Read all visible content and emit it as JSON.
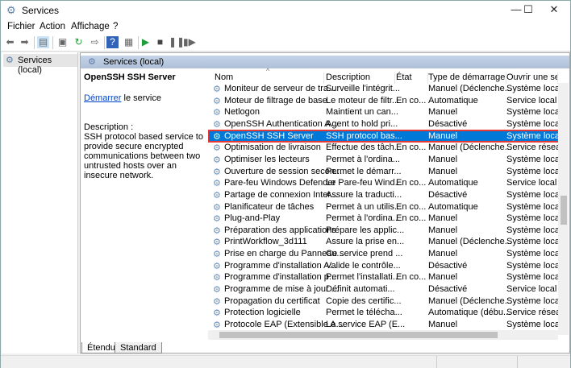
{
  "window": {
    "title": "Services",
    "minimize": "—",
    "maximize": "☐",
    "close": "✕"
  },
  "menu": [
    "Fichier",
    "Action",
    "Affichage",
    "?"
  ],
  "tree": {
    "root": "Services (local)"
  },
  "panel": {
    "header": "Services (local)",
    "service_name": "OpenSSH SSH Server",
    "start_link": "Démarrer",
    "start_suffix": " le service",
    "description_label": "Description :",
    "description": "SSH protocol based service to provide secure encrypted communications between two untrusted hosts over an insecure network."
  },
  "columns": [
    "Nom",
    "Description",
    "État",
    "Type de démarrage",
    "Ouvrir une sessi"
  ],
  "rows": [
    [
      "Moniteur de serveur de tra...",
      "Surveille l'intégrit...",
      "",
      "Manuel (Déclenche...",
      "Système local"
    ],
    [
      "Moteur de filtrage de base",
      "Le moteur de filtr...",
      "En co...",
      "Automatique",
      "Service local"
    ],
    [
      "Netlogon",
      "Maintient un can...",
      "",
      "Manuel",
      "Système local"
    ],
    [
      "OpenSSH Authentication A...",
      "Agent to hold pri...",
      "",
      "Désactivé",
      "Système local"
    ],
    [
      "OpenSSH SSH Server",
      "SSH protocol bas...",
      "",
      "Manuel",
      "Système local"
    ],
    [
      "Optimisation de livraison",
      "Effectue des tâch...",
      "En co...",
      "Manuel (Déclenche...",
      "Service réseau"
    ],
    [
      "Optimiser les lecteurs",
      "Permet à l'ordina...",
      "",
      "Manuel",
      "Système local"
    ],
    [
      "Ouverture de session secon...",
      "Permet le démarr...",
      "",
      "Manuel",
      "Système local"
    ],
    [
      "Pare-feu Windows Defender",
      "Le Pare-feu Wind...",
      "En co...",
      "Automatique",
      "Service local"
    ],
    [
      "Partage de connexion Inter...",
      "Assure la traducti...",
      "",
      "Désactivé",
      "Système local"
    ],
    [
      "Planificateur de tâches",
      "Permet à un utilis...",
      "En co...",
      "Automatique",
      "Système local"
    ],
    [
      "Plug-and-Play",
      "Permet à l'ordina...",
      "En co...",
      "Manuel",
      "Système local"
    ],
    [
      "Préparation des applications",
      "Prépare les applic...",
      "",
      "Manuel",
      "Système local"
    ],
    [
      "PrintWorkflow_3d111",
      "Assure la prise en...",
      "",
      "Manuel (Déclenche...",
      "Système local"
    ],
    [
      "Prise en charge du Panneau...",
      "Ce service prend ...",
      "",
      "Manuel",
      "Système local"
    ],
    [
      "Programme d'installation A...",
      "Valide le contrôle...",
      "",
      "Désactivé",
      "Système local"
    ],
    [
      "Programme d'installation p...",
      "Permet l'installati...",
      "En co...",
      "Manuel",
      "Système local"
    ],
    [
      "Programme de mise à jour ...",
      "Définit automati...",
      "",
      "Désactivé",
      "Service local"
    ],
    [
      "Propagation du certificat",
      "Copie des certific...",
      "",
      "Manuel (Déclenche...",
      "Système local"
    ],
    [
      "Protection logicielle",
      "Permet le télécha...",
      "",
      "Automatique (débu...",
      "Service réseau"
    ],
    [
      "Protocole EAP (Extensible A...",
      "Le service EAP (E...",
      "",
      "Manuel",
      "Système local"
    ]
  ],
  "selected_row": 4,
  "tabs": [
    "Étendu",
    "Standard"
  ]
}
